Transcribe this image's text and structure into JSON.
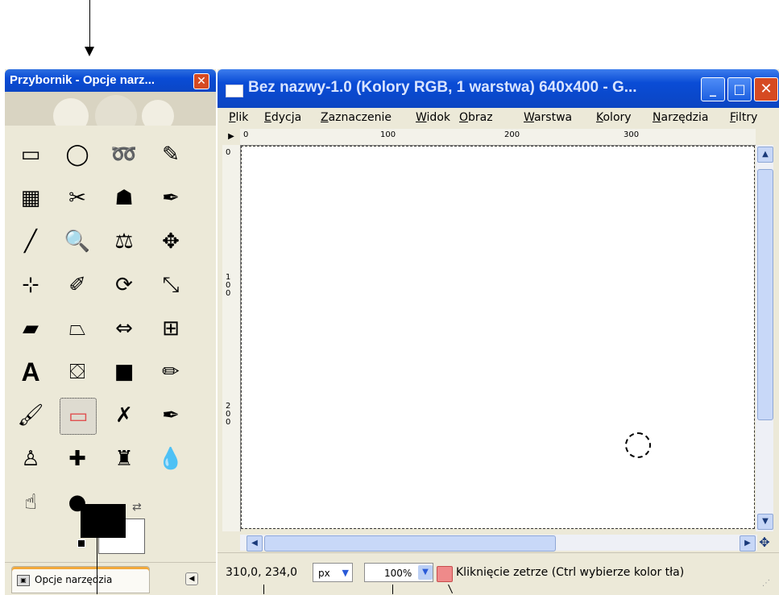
{
  "toolbox": {
    "title": "Przybornik - Opcje narz...",
    "close_label": "✕",
    "tools": [
      {
        "name": "rect-select-tool-icon",
        "glyph": "▭"
      },
      {
        "name": "ellipse-select-tool-icon",
        "glyph": "◯"
      },
      {
        "name": "free-select-tool-icon",
        "glyph": "➿"
      },
      {
        "name": "fuzzy-select-tool-icon",
        "glyph": "✎"
      },
      {
        "name": "select-by-color-tool-icon",
        "glyph": "▦"
      },
      {
        "name": "scissors-tool-icon",
        "glyph": "✂"
      },
      {
        "name": "foreground-select-tool-icon",
        "glyph": "☗"
      },
      {
        "name": "paths-tool-icon",
        "glyph": "✒"
      },
      {
        "name": "color-picker-tool-icon",
        "glyph": "╱"
      },
      {
        "name": "zoom-tool-icon",
        "glyph": "🔍"
      },
      {
        "name": "measure-tool-icon",
        "glyph": "⚖"
      },
      {
        "name": "move-tool-icon",
        "glyph": "✥"
      },
      {
        "name": "align-tool-icon",
        "glyph": "⊹"
      },
      {
        "name": "crop-tool-icon",
        "glyph": "✐"
      },
      {
        "name": "rotate-tool-icon",
        "glyph": "⟳"
      },
      {
        "name": "scale-tool-icon",
        "glyph": "⤡"
      },
      {
        "name": "shear-tool-icon",
        "glyph": "▰"
      },
      {
        "name": "perspective-tool-icon",
        "glyph": "⏢"
      },
      {
        "name": "flip-tool-icon",
        "glyph": "⇔"
      },
      {
        "name": "cage-transform-tool-icon",
        "glyph": "⊞"
      },
      {
        "name": "text-tool-icon",
        "glyph": "A"
      },
      {
        "name": "bucket-fill-tool-icon",
        "glyph": "⛋"
      },
      {
        "name": "blend-tool-icon",
        "glyph": "■"
      },
      {
        "name": "pencil-tool-icon",
        "glyph": "✏"
      },
      {
        "name": "paintbrush-tool-icon",
        "glyph": "🖌"
      },
      {
        "name": "eraser-tool-icon",
        "glyph": "▭"
      },
      {
        "name": "airbrush-tool-icon",
        "glyph": "✗"
      },
      {
        "name": "ink-tool-icon",
        "glyph": "✒"
      },
      {
        "name": "clone-tool-icon",
        "glyph": "♙"
      },
      {
        "name": "heal-tool-icon",
        "glyph": "✚"
      },
      {
        "name": "perspective-clone-tool-icon",
        "glyph": "♜"
      },
      {
        "name": "blur-sharpen-tool-icon",
        "glyph": "💧"
      },
      {
        "name": "smudge-tool-icon",
        "glyph": "☝"
      },
      {
        "name": "dodge-burn-tool-icon",
        "glyph": "●"
      }
    ],
    "active_tool_index": 25,
    "colors": {
      "foreground": "#000000",
      "background": "#ffffff"
    },
    "tab_label": "Opcje narzędzia"
  },
  "image_window": {
    "title": "Bez nazwy-1.0 (Kolory RGB, 1 warstwa) 640x400 - G...",
    "minimize_label": "_",
    "maximize_label": "□",
    "close_label": "✕",
    "menu": [
      {
        "underline": "P",
        "rest": "lik"
      },
      {
        "underline": "E",
        "rest": "dycja"
      },
      {
        "underline": "Z",
        "rest": "aznaczenie"
      },
      {
        "underline": "W",
        "rest": "idok"
      },
      {
        "underline": "O",
        "rest": "braz"
      },
      {
        "underline": "W",
        "rest": "arstwa"
      },
      {
        "underline": "K",
        "rest": "olory"
      },
      {
        "underline": "N",
        "rest": "arzędzia"
      },
      {
        "underline": "F",
        "rest": "iltry"
      }
    ],
    "ruler_h_labels": [
      "0",
      "100",
      "200",
      "300"
    ],
    "ruler_v_labels": [
      "0",
      "1\n0\n0",
      "2\n0\n0"
    ],
    "status": {
      "coords": "310,0, 234,0",
      "unit": "px",
      "zoom": "100%",
      "hint": "Kliknięcie zetrze (Ctrl wybierze kolor tła)"
    }
  }
}
